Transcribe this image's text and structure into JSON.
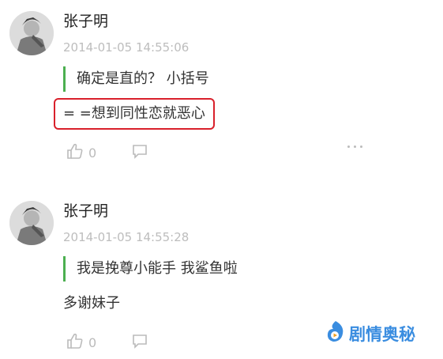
{
  "comments": [
    {
      "username": "张子明",
      "timestamp": "2014-01-05 14:55:06",
      "quote": "确定是直的？ 小括号",
      "reply": "= =想到同性恋就恶心",
      "like_count": "0"
    },
    {
      "username": "张子明",
      "timestamp": "2014-01-05 14:55:28",
      "quote": "我是挽尊小能手 我鲨鱼啦",
      "reply": "多谢妹子",
      "like_count": "0"
    }
  ],
  "watermark": {
    "text": "剧情奥秘"
  },
  "colors": {
    "quote_bar": "#4caf50",
    "highlight_border": "#d9202b",
    "watermark": "#3a8de0",
    "muted": "#bdbdbd"
  },
  "icons": [
    "avatar",
    "thumbs-up-icon",
    "comment-icon",
    "more-icon",
    "watermark-logo-icon"
  ]
}
